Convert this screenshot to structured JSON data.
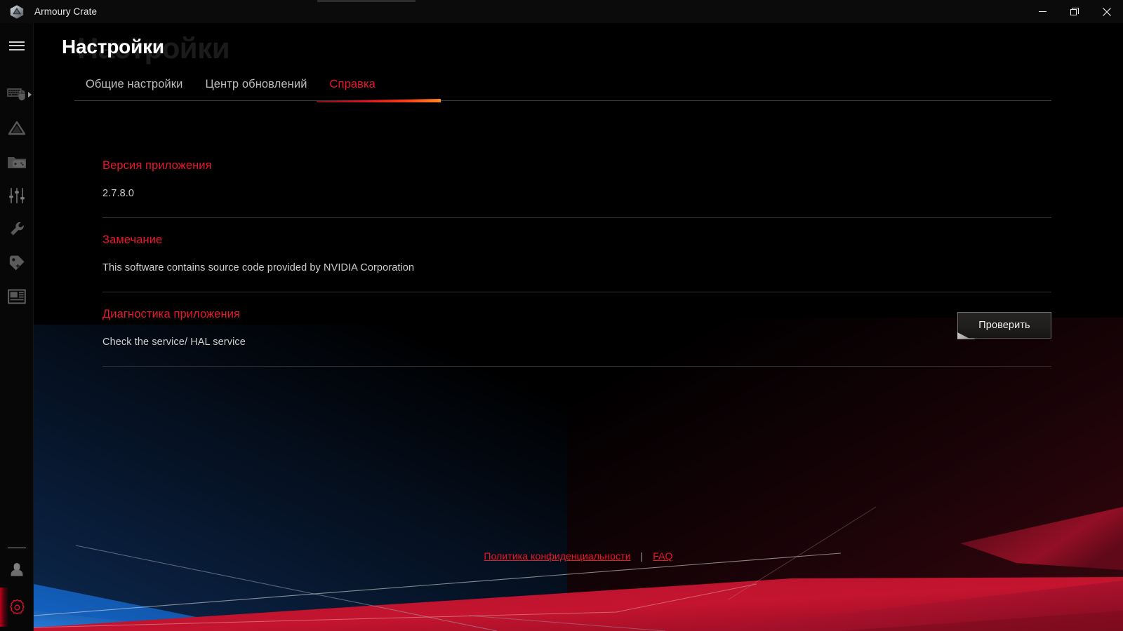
{
  "window": {
    "app_title": "Armoury Crate",
    "logo_icon": "armoury-crate-hexagon-logo",
    "controls": {
      "minimize": "minimize-icon",
      "restore": "restore-icon",
      "close": "close-icon"
    }
  },
  "sidebar": {
    "menu_icon": "hamburger-menu-icon",
    "items": [
      {
        "icon": "keyboard-mouse-device-icon",
        "has_expand_arrow": true
      },
      {
        "icon": "aura-sync-triangle-icon",
        "has_expand_arrow": false
      },
      {
        "icon": "game-library-folder-icon",
        "has_expand_arrow": false
      },
      {
        "icon": "scenario-profiles-sliders-icon",
        "has_expand_arrow": false
      },
      {
        "icon": "tools-wrench-icon",
        "has_expand_arrow": false
      },
      {
        "icon": "featured-deals-tag-icon",
        "has_expand_arrow": false
      },
      {
        "icon": "news-window-icon",
        "has_expand_arrow": false
      }
    ],
    "bottom_items": [
      {
        "icon": "user-account-icon",
        "active": false
      },
      {
        "icon": "settings-gear-icon",
        "active": true
      }
    ]
  },
  "page": {
    "title": "Настройки",
    "ghost_title": "Настройки"
  },
  "tabs": [
    {
      "label": "Общие настройки",
      "active": false
    },
    {
      "label": "Центр обновлений",
      "active": false
    },
    {
      "label": "Справка",
      "active": true
    }
  ],
  "sections": [
    {
      "title": "Версия приложения",
      "text": "2.7.8.0",
      "has_button": false
    },
    {
      "title": "Замечание",
      "text": "This software contains source code provided by NVIDIA Corporation",
      "has_button": false
    },
    {
      "title": "Диагностика приложения",
      "text": "Check the service/ HAL service",
      "has_button": true,
      "button_label": "Проверить"
    }
  ],
  "footer": {
    "privacy_label": "Политика конфиденциальности",
    "separator": "|",
    "faq_label": "FAQ"
  },
  "colors": {
    "accent_red": "#e8172b",
    "background": "#000000",
    "sidebar": "#070707",
    "titlebar": "#0b0b0b",
    "divider": "#303030",
    "body_text": "#cfcfcf"
  }
}
